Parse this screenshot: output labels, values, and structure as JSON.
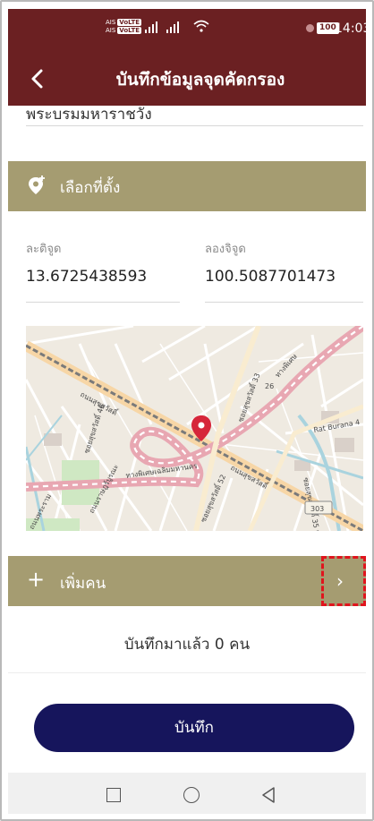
{
  "status_bar": {
    "carrier_top": "AIS",
    "carrier_bottom": "AIS",
    "volte": "VoLTE",
    "battery": "100",
    "time": "14:03"
  },
  "app_bar": {
    "title": "บันทึกข้อมูลจุดคัดกรอง",
    "back_icon": "chevron-left-icon"
  },
  "previous_field": {
    "value": "พระบรมมหาราชวัง"
  },
  "location_section": {
    "icon": "map-pin-add-icon",
    "label": "เลือกที่ตั้ง"
  },
  "coordinates": {
    "latitude_label": "ละติจูด",
    "latitude_value": "13.6725438593",
    "longitude_label": "ลองจิจูด",
    "longitude_value": "100.5087701473"
  },
  "map": {
    "labels": {
      "road_a": "ถนนสุขสวัสดิ์",
      "road_b": "ทางพิเศษเฉลิมมหานคร",
      "road_c": "ถนนราษฎร์บูรณะ",
      "road_d": "ถนนสุขสวัสดิ์",
      "soi_1": "ซอยสุขสวัสดิ์ 46",
      "soi_2": "ซอยสุขสวัสดิ์ 52",
      "soi_3": "ซอยสุขสวัสดิ์ 33",
      "soi_4": "ซอยสุขสวัสดิ์ 35 แยก 2",
      "road_e": "ถนนพระราม",
      "road_f": "ทางพิเศษ",
      "place": "Rat Burana 4",
      "route_number": "303",
      "km_marker": "26"
    },
    "marker_color": "#d6263a"
  },
  "add_person_section": {
    "icon": "plus-icon",
    "label": "เพิ่มคน",
    "chevron_icon": "chevron-right-icon"
  },
  "record_count": {
    "text": "บันทึกมาแล้ว 0 คน"
  },
  "save_button": {
    "label": "บันทึก"
  },
  "nav_bar": {
    "recents_icon": "square-icon",
    "home_icon": "circle-icon",
    "back_icon": "triangle-back-icon"
  },
  "colors": {
    "app_bar": "#6b2022",
    "section_header": "#a59c71",
    "save_button": "#16155c",
    "highlight": "#e0141d"
  }
}
